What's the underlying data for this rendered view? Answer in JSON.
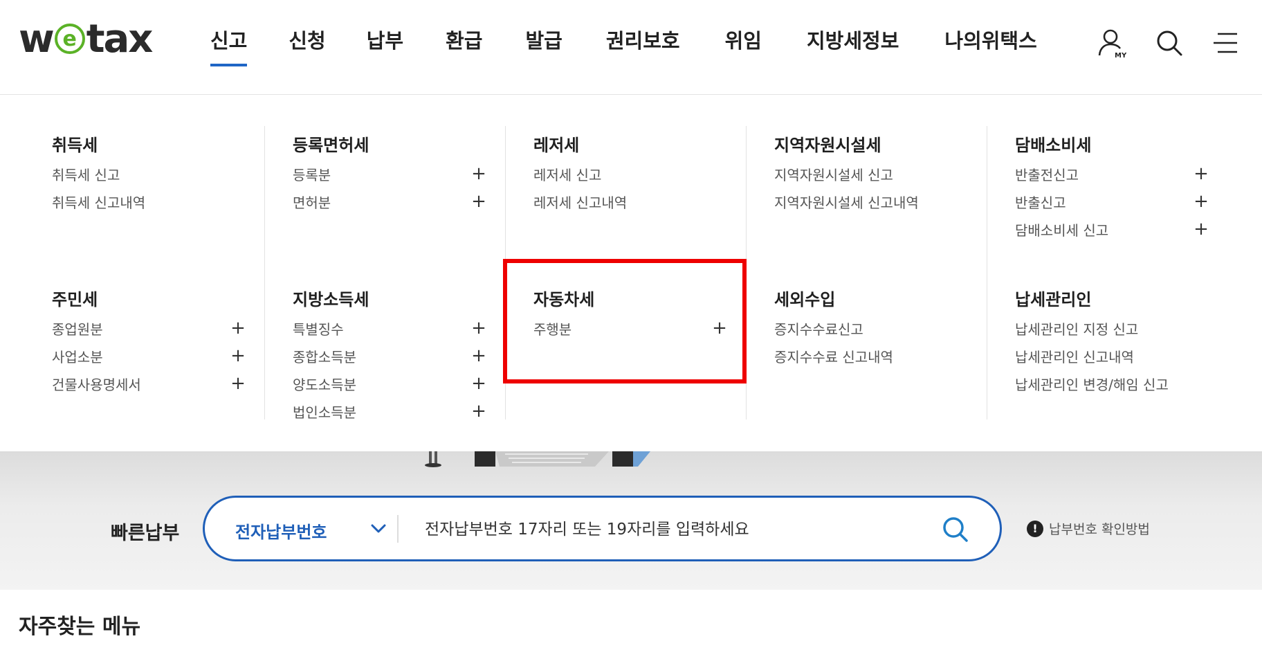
{
  "logo": {
    "pre": "w",
    "circle": "e",
    "post": "tax"
  },
  "gnb": [
    {
      "label": "신고",
      "active": true
    },
    {
      "label": "신청"
    },
    {
      "label": "납부"
    },
    {
      "label": "환급"
    },
    {
      "label": "발급"
    },
    {
      "label": "권리보호"
    },
    {
      "label": "위임"
    },
    {
      "label": "지방세정보"
    },
    {
      "label": "나의위택스"
    }
  ],
  "header_icons": {
    "my_icon": "user-my-icon",
    "search_icon": "search-icon",
    "menu_icon": "hamburger-menu-icon",
    "my_badge": "MY"
  },
  "mega": {
    "groups": [
      {
        "title": "취득세",
        "items": [
          {
            "label": "취득세 신고",
            "plus": false
          },
          {
            "label": "취득세 신고내역",
            "plus": false
          }
        ]
      },
      {
        "title": "등록면허세",
        "items": [
          {
            "label": "등록분",
            "plus": true
          },
          {
            "label": "면허분",
            "plus": true
          }
        ]
      },
      {
        "title": "레저세",
        "items": [
          {
            "label": "레저세 신고",
            "plus": false
          },
          {
            "label": "레저세 신고내역",
            "plus": false
          }
        ]
      },
      {
        "title": "지역자원시설세",
        "items": [
          {
            "label": "지역자원시설세 신고",
            "plus": false
          },
          {
            "label": "지역자원시설세 신고내역",
            "plus": false
          }
        ]
      },
      {
        "title": "담배소비세",
        "items": [
          {
            "label": "반출전신고",
            "plus": true
          },
          {
            "label": "반출신고",
            "plus": true
          },
          {
            "label": "담배소비세 신고",
            "plus": true
          }
        ]
      },
      {
        "title": "주민세",
        "items": [
          {
            "label": "종업원분",
            "plus": true
          },
          {
            "label": "사업소분",
            "plus": true
          },
          {
            "label": "건물사용명세서",
            "plus": true
          }
        ]
      },
      {
        "title": "지방소득세",
        "items": [
          {
            "label": "특별징수",
            "plus": true
          },
          {
            "label": "종합소득분",
            "plus": true
          },
          {
            "label": "양도소득분",
            "plus": true
          },
          {
            "label": "법인소득분",
            "plus": true
          }
        ]
      },
      {
        "title": "자동차세",
        "items": [
          {
            "label": "주행분",
            "plus": true
          }
        ]
      },
      {
        "title": "세외수입",
        "items": [
          {
            "label": "증지수수료신고",
            "plus": false
          },
          {
            "label": "증지수수료 신고내역",
            "plus": false
          }
        ]
      },
      {
        "title": "납세관리인",
        "items": [
          {
            "label": "납세관리인 지정 신고",
            "plus": false
          },
          {
            "label": "납세관리인 신고내역",
            "plus": false
          },
          {
            "label": "납세관리인 변경/해임 신고",
            "plus": false
          }
        ]
      }
    ],
    "plus_symbol": "+"
  },
  "quickpay": {
    "label": "빠른납부",
    "select_value": "전자납부번호",
    "placeholder": "전자납부번호 17자리 또는 19자리를 입력하세요",
    "help_icon": "!",
    "help_text": "납부번호 확인방법"
  },
  "favorites": {
    "title": "자주찾는 메뉴"
  },
  "colors": {
    "accent": "#1f66c6",
    "logo_green": "#5bb227",
    "highlight": "#ee0000"
  }
}
